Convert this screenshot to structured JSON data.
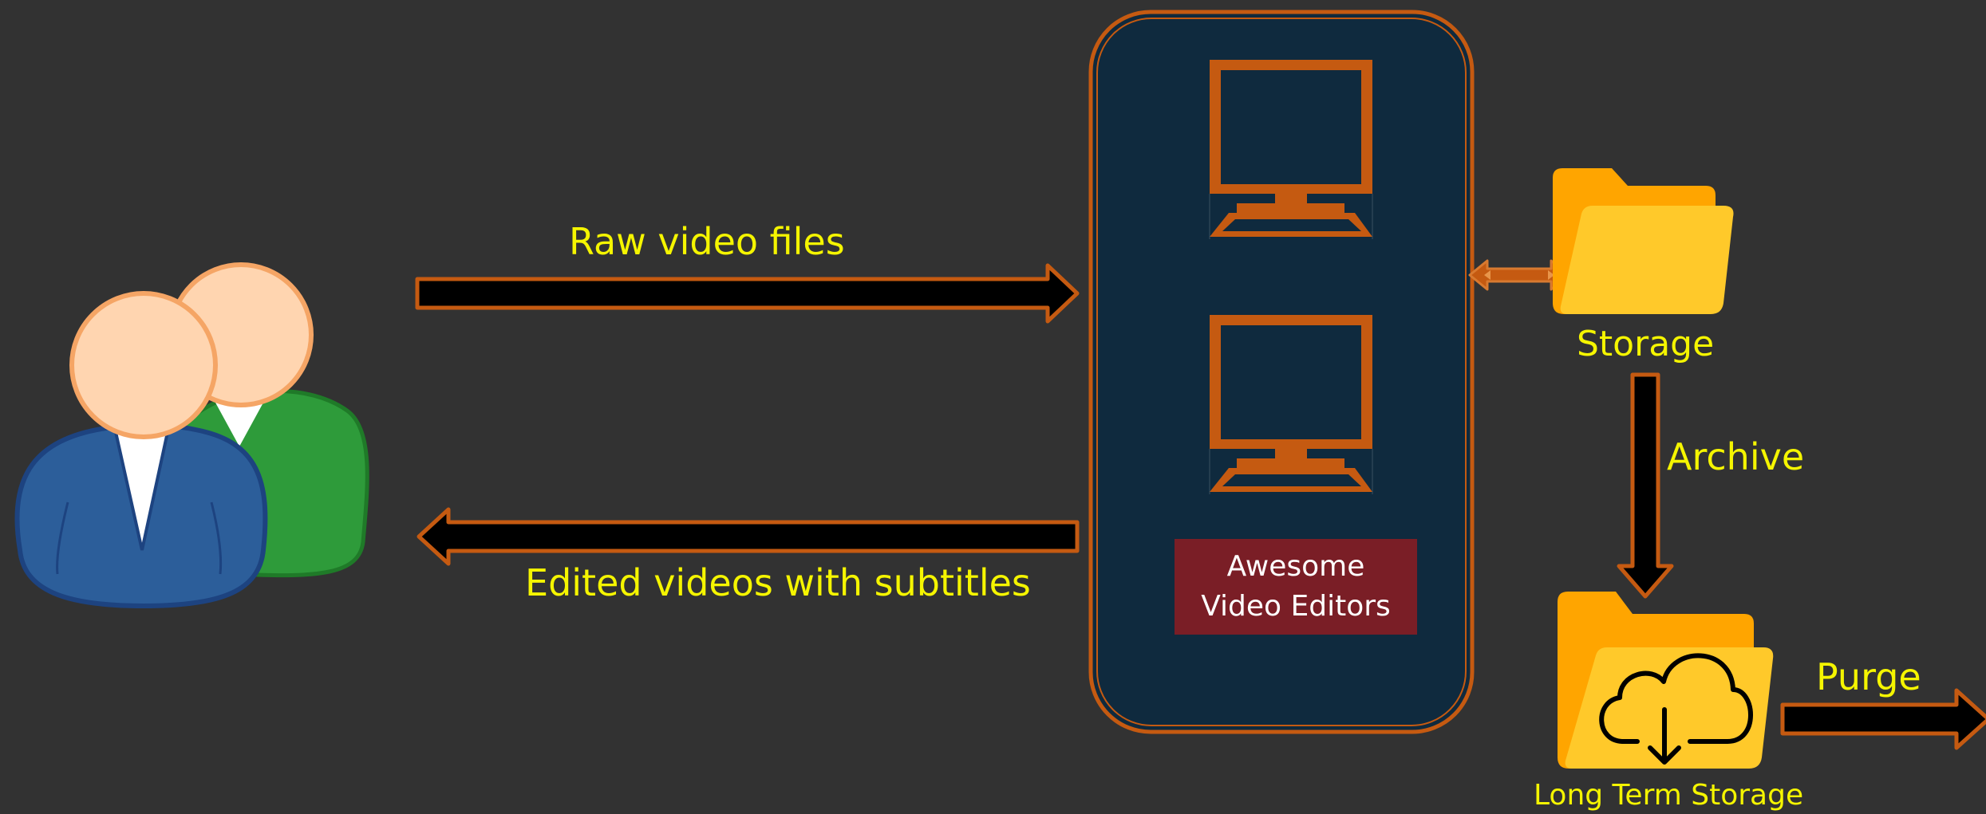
{
  "labels": {
    "raw_video": "Raw video files",
    "edited_videos": "Edited videos with subtitles",
    "editors_line1": "Awesome",
    "editors_line2": "Video Editors",
    "storage": "Storage",
    "archive": "Archive",
    "long_term_storage": "Long Term Storage",
    "purge": "Purge"
  },
  "icons": {
    "users": "users-icon",
    "computer": "computer-icon",
    "folder": "folder-icon",
    "cloud_download": "cloud-download-icon"
  },
  "colors": {
    "background": "#323232",
    "text": "#f5f500",
    "accent": "#c55a11",
    "panel": "#0f2a3e",
    "editors_label_bg": "#7a1e26",
    "folder_back": "#ffa500",
    "folder_front": "#ffc92a"
  }
}
